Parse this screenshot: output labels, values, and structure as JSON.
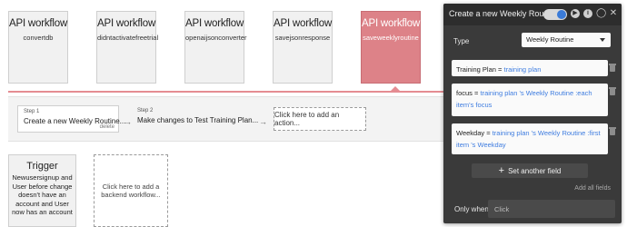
{
  "workflows": [
    {
      "title": "API workflow",
      "name": "convertdb"
    },
    {
      "title": "API workflow",
      "name": "didntactivatefreetrial"
    },
    {
      "title": "API workflow",
      "name": "openaijsonconverter"
    },
    {
      "title": "API workflow",
      "name": "savejsonresponse"
    },
    {
      "title": "API workflow",
      "name": "saveweeklyroutine"
    }
  ],
  "steps": [
    {
      "number": "Step 1",
      "label": "Create a new Weekly Routine...",
      "delete_label": "delete"
    },
    {
      "number": "Step 2",
      "label": "Make changes to Test Training Plan..."
    }
  ],
  "add_action_label": "Click here to add an action...",
  "trigger": {
    "title": "Trigger",
    "description": "Newusersignup and User before change doesn't have an account and User now has an account"
  },
  "backend_add_label": "Click here to add a backend workflow...",
  "editor": {
    "title": "Create a new Weekly Routine...",
    "icons": [
      "toggle-switch",
      "play-icon",
      "info-icon",
      "comment-icon",
      "close-icon"
    ],
    "type_label": "Type",
    "type_value": "Weekly Routine",
    "fields": [
      {
        "name": "Training Plan",
        "operator": "=",
        "value": "training plan"
      },
      {
        "name": "focus",
        "operator": "=",
        "value": "training plan 's Weekly Routine :each item's focus"
      },
      {
        "name": "Weekday",
        "operator": "=",
        "value": "training plan 's Weekly Routine :first item 's Weekday"
      }
    ],
    "set_another_field_label": "Set another field",
    "add_all_fields_label": "Add all fields",
    "only_when_label": "Only when",
    "only_when_placeholder": "Click"
  },
  "colors": {
    "active_workflow": "#dd8288",
    "editor_background": "#3a3a3a",
    "expression_blue": "#3f7de0",
    "toggle_knob": "#3b7bd8"
  }
}
